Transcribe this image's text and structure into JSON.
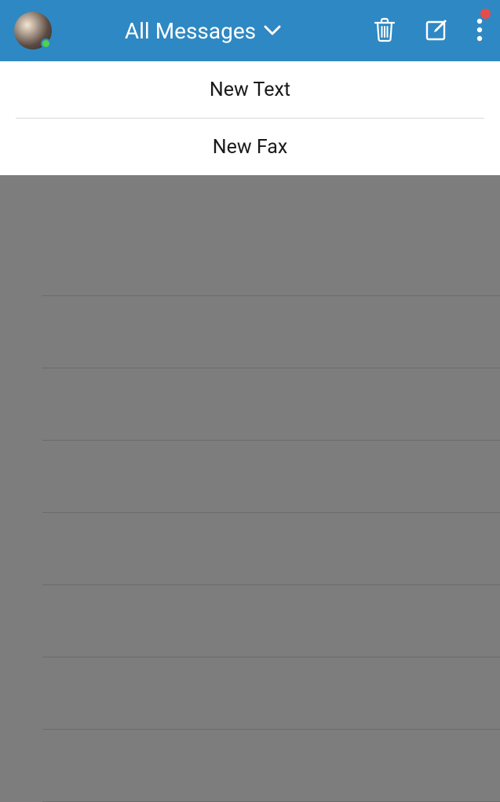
{
  "header": {
    "title": "All Messages"
  },
  "compose_menu": {
    "items": [
      {
        "label": "New Text"
      },
      {
        "label": "New Fax"
      }
    ]
  },
  "colors": {
    "header_bg": "#2e88c3",
    "presence": "#4fd14f",
    "notification": "#e44d4d"
  }
}
